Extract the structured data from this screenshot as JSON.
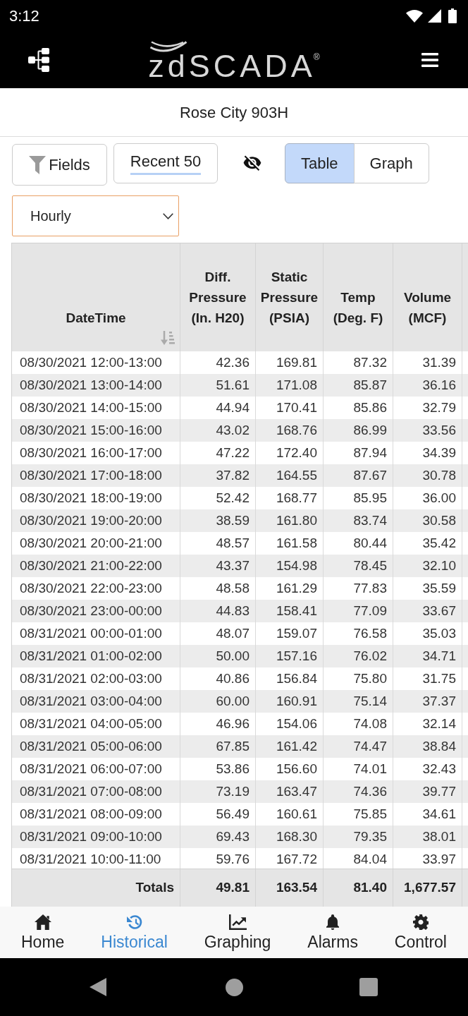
{
  "status_bar": {
    "time": "3:12"
  },
  "app_bar": {
    "logo": {
      "wordmark": "zdSCADA",
      "registered_mark": "®"
    }
  },
  "page_title": "Rose City 903H",
  "toolbar": {
    "fields_button": {
      "label": "Fields"
    },
    "recent_button": {
      "label": "Recent 50"
    },
    "view_toggle": [
      {
        "label": "Table",
        "selected": true
      },
      {
        "label": "Graph",
        "selected": false
      }
    ]
  },
  "interval_select": {
    "value": "Hourly"
  },
  "table": {
    "columns": [
      {
        "label": "DateTime",
        "sorted": true
      },
      {
        "label": "Diff. Pressure (In. H20)",
        "sorted": false
      },
      {
        "label": "Static Pressure (PSIA)",
        "sorted": false
      },
      {
        "label": "Temp (Deg. F)",
        "sorted": false
      },
      {
        "label": "Volume (MCF)",
        "sorted": false
      }
    ],
    "rows": [
      [
        "08/30/2021 12:00-13:00",
        "42.36",
        "169.81",
        "87.32",
        "31.39"
      ],
      [
        "08/30/2021 13:00-14:00",
        "51.61",
        "171.08",
        "85.87",
        "36.16"
      ],
      [
        "08/30/2021 14:00-15:00",
        "44.94",
        "170.41",
        "85.86",
        "32.79"
      ],
      [
        "08/30/2021 15:00-16:00",
        "43.02",
        "168.76",
        "86.99",
        "33.56"
      ],
      [
        "08/30/2021 16:00-17:00",
        "47.22",
        "172.40",
        "87.94",
        "34.39"
      ],
      [
        "08/30/2021 17:00-18:00",
        "37.82",
        "164.55",
        "87.67",
        "30.78"
      ],
      [
        "08/30/2021 18:00-19:00",
        "52.42",
        "168.77",
        "85.95",
        "36.00"
      ],
      [
        "08/30/2021 19:00-20:00",
        "38.59",
        "161.80",
        "83.74",
        "30.58"
      ],
      [
        "08/30/2021 20:00-21:00",
        "48.57",
        "161.58",
        "80.44",
        "35.42"
      ],
      [
        "08/30/2021 21:00-22:00",
        "43.37",
        "154.98",
        "78.45",
        "32.10"
      ],
      [
        "08/30/2021 22:00-23:00",
        "48.58",
        "161.29",
        "77.83",
        "35.59"
      ],
      [
        "08/30/2021 23:00-00:00",
        "44.83",
        "158.41",
        "77.09",
        "33.67"
      ],
      [
        "08/31/2021 00:00-01:00",
        "48.07",
        "159.07",
        "76.58",
        "35.03"
      ],
      [
        "08/31/2021 01:00-02:00",
        "50.00",
        "157.16",
        "76.02",
        "34.71"
      ],
      [
        "08/31/2021 02:00-03:00",
        "40.86",
        "156.84",
        "75.80",
        "31.75"
      ],
      [
        "08/31/2021 03:00-04:00",
        "60.00",
        "160.91",
        "75.14",
        "37.37"
      ],
      [
        "08/31/2021 04:00-05:00",
        "46.96",
        "154.06",
        "74.08",
        "32.14"
      ],
      [
        "08/31/2021 05:00-06:00",
        "67.85",
        "161.42",
        "74.47",
        "38.84"
      ],
      [
        "08/31/2021 06:00-07:00",
        "53.86",
        "156.60",
        "74.01",
        "32.43"
      ],
      [
        "08/31/2021 07:00-08:00",
        "73.19",
        "163.47",
        "74.36",
        "39.77"
      ],
      [
        "08/31/2021 08:00-09:00",
        "56.49",
        "160.61",
        "75.85",
        "34.61"
      ],
      [
        "08/31/2021 09:00-10:00",
        "69.43",
        "168.30",
        "79.35",
        "38.01"
      ],
      [
        "08/31/2021 10:00-11:00",
        "59.76",
        "167.72",
        "84.04",
        "33.97"
      ]
    ],
    "totals": [
      "Totals",
      "49.81",
      "163.54",
      "81.40",
      "1,677.57"
    ]
  },
  "bottom_nav": [
    {
      "label": "Home",
      "selected": false
    },
    {
      "label": "Historical",
      "selected": true
    },
    {
      "label": "Graphing",
      "selected": false
    },
    {
      "label": "Alarms",
      "selected": false
    },
    {
      "label": "Control",
      "selected": false
    }
  ]
}
